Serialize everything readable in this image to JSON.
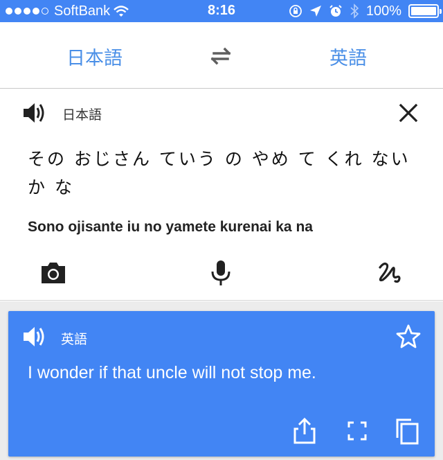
{
  "status_bar": {
    "carrier": "SoftBank",
    "time": "8:16",
    "battery": "100%",
    "signal_bars_filled": 4,
    "signal_bars_total": 5,
    "icons": [
      "wifi-icon",
      "orientation-lock-icon",
      "location-arrow-icon",
      "alarm-icon",
      "bluetooth-icon",
      "battery-icon"
    ]
  },
  "language_bar": {
    "source_language": "日本語",
    "target_language": "英語",
    "swap_icon": "swap-arrows-icon"
  },
  "input": {
    "language_label": "日本語",
    "text": "その おじさん ていう の やめ て くれ ない か な",
    "romanization": "Sono ojisante iu no yamete kurenai ka na",
    "icons": [
      "speaker-icon",
      "close-icon",
      "camera-icon",
      "microphone-icon",
      "handwriting-icon"
    ]
  },
  "result": {
    "language_label": "英語",
    "text": "I wonder if that uncle will not stop me.",
    "icons": [
      "speaker-icon",
      "star-icon",
      "share-icon",
      "fullscreen-icon",
      "copy-icon"
    ]
  },
  "colors": {
    "accent_blue": "#4285f4",
    "language_text_blue": "#4a8fe7",
    "background_gray": "#ececec",
    "icon_dark": "#212121"
  }
}
